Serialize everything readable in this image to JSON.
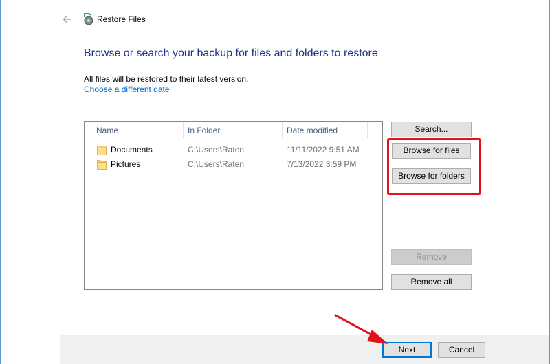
{
  "window": {
    "title": "Restore Files",
    "back_icon": "back-arrow-icon",
    "app_icon": "restore-files-icon"
  },
  "main": {
    "heading": "Browse or search your backup for files and folders to restore",
    "info": "All files will be restored to their latest version.",
    "link": "Choose a different date"
  },
  "filelist": {
    "columns": [
      "Name",
      "In Folder",
      "Date modified"
    ],
    "rows": [
      {
        "name": "Documents",
        "folder": "C:\\Users\\Raten",
        "date": "11/11/2022 9:51 AM",
        "icon": "folder-icon"
      },
      {
        "name": "Pictures",
        "folder": "C:\\Users\\Raten",
        "date": "7/13/2022 3:59 PM",
        "icon": "folder-icon"
      }
    ]
  },
  "buttons": {
    "search": "Search...",
    "browse_files": "Browse for files",
    "browse_folders": "Browse for folders",
    "remove": "Remove",
    "remove_all": "Remove all",
    "next": "Next",
    "cancel": "Cancel"
  },
  "colors": {
    "heading": "#1e3287",
    "link": "#0066cc",
    "highlight": "#e3121c",
    "accent": "#0078d7"
  }
}
